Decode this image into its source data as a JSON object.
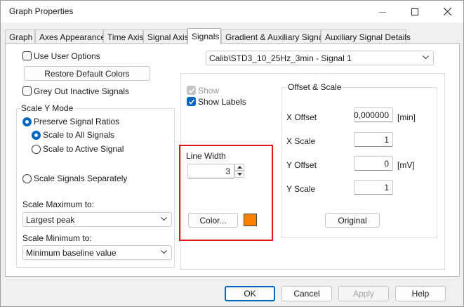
{
  "window": {
    "title": "Graph Properties"
  },
  "tabs": [
    "Graph",
    "Axes Appearance",
    "Time Axis",
    "Signal Axis",
    "Signals",
    "Gradient & Auxiliary Signals",
    "Auxiliary Signal Details"
  ],
  "active_tab": "Signals",
  "left": {
    "use_user_options": {
      "label": "Use User Options",
      "checked": false
    },
    "restore_button": "Restore Default Colors",
    "grey_out": {
      "label": "Grey Out Inactive Signals",
      "checked": false
    },
    "scale_y_mode": {
      "title": "Scale Y Mode",
      "preserve": "Preserve Signal Ratios",
      "all": "Scale to All Signals",
      "active": "Scale to Active Signal",
      "separately": "Scale Signals Separately",
      "selected": "preserve",
      "sub_selected": "all"
    },
    "scale_max": {
      "label": "Scale Maximum to:",
      "value": "Largest peak"
    },
    "scale_min": {
      "label": "Scale Minimum to:",
      "value": "Minimum baseline value"
    }
  },
  "signal_select": {
    "value": "Calib\\STD3_10_25Hz_3min - Signal 1"
  },
  "display": {
    "show": {
      "label": "Show",
      "checked": true,
      "disabled": true
    },
    "show_labels": {
      "label": "Show Labels",
      "checked": true
    }
  },
  "line": {
    "width_label": "Line Width",
    "width_value": "3",
    "color_button": "Color...",
    "color": "#ff8000"
  },
  "offset_scale": {
    "title": "Offset & Scale",
    "x_offset": {
      "label": "X Offset",
      "value": "0,000000",
      "unit": "[min]"
    },
    "x_scale": {
      "label": "X Scale",
      "value": "1"
    },
    "y_offset": {
      "label": "Y Offset",
      "value": "0",
      "unit": "[mV]"
    },
    "y_scale": {
      "label": "Y Scale",
      "value": "1"
    },
    "original_button": "Original"
  },
  "footer": {
    "ok": "OK",
    "cancel": "Cancel",
    "apply": "Apply",
    "help": "Help"
  },
  "colors": {
    "accent": "#0067c0",
    "highlight": "#e0181b"
  }
}
